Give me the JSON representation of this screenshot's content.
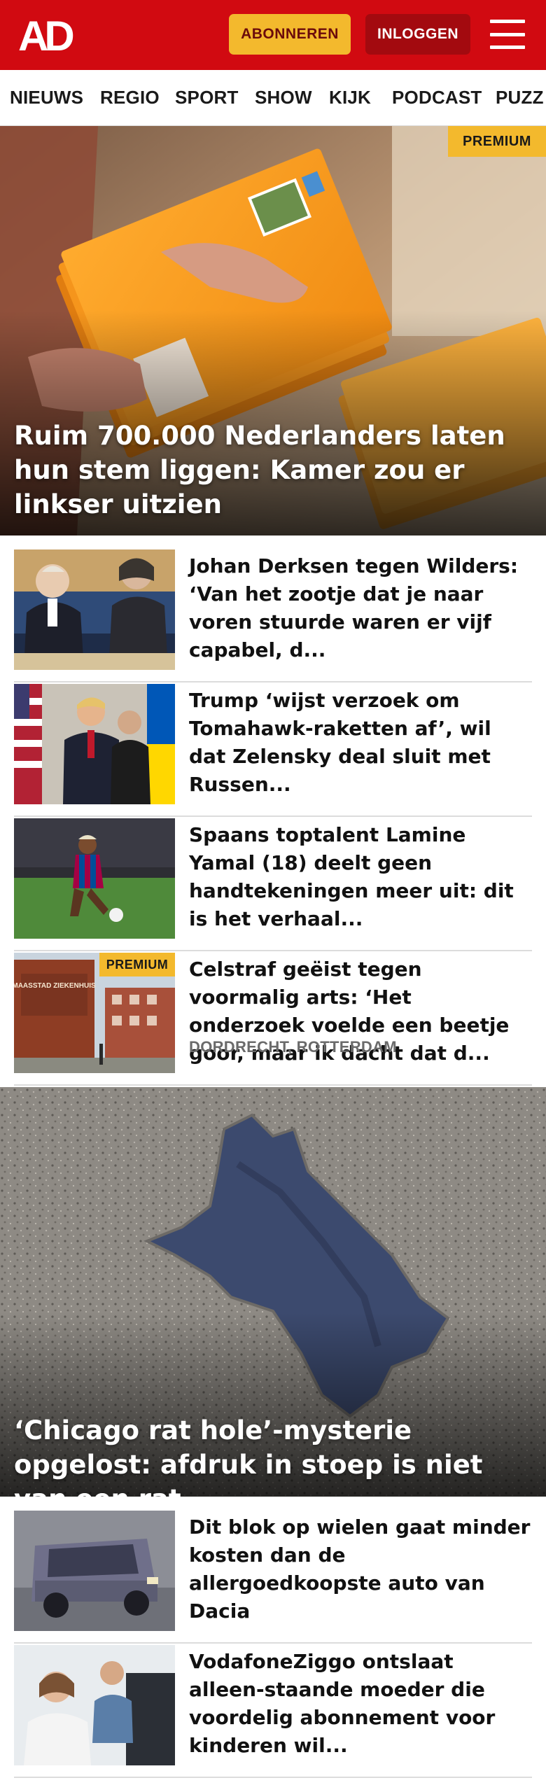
{
  "header": {
    "logo_text": "AD",
    "subscribe_label": "ABONNEREN",
    "login_label": "INLOGGEN",
    "brand_red": "#d10a11"
  },
  "nav": {
    "items": [
      "NIEUWS",
      "REGIO",
      "SPORT",
      "SHOW",
      "KIJK",
      "PODCAST",
      "PUZZ"
    ]
  },
  "hero1": {
    "title": "Ruim 700.000 Nederlanders laten hun stem liggen: Kamer zou er linkser uitzien",
    "badge": "PREMIUM"
  },
  "articles1": [
    {
      "title": "Johan Derksen tegen Wilders: ‘Van het zootje dat je naar voren stuurde waren er vijf capabel, d...",
      "meta": "",
      "badge": ""
    },
    {
      "title": "Trump ‘wijst verzoek om Tomahawk-raketten af’, wil dat Zelensky deal sluit met Russen...",
      "meta": "",
      "badge": ""
    },
    {
      "title": "Spaans toptalent Lamine Yamal (18) deelt geen handtekeningen meer uit: dit is het verhaal...",
      "meta": "",
      "badge": ""
    },
    {
      "title": "Celstraf geëist tegen voormalig arts: ‘Het onderzoek voelde een beetje goor, maar ik dacht dat d...",
      "meta": "DORDRECHT, ROTTERDAM",
      "badge": "PREMIUM",
      "sign_text": "MAASSTAD ZIEKENHUIS"
    }
  ],
  "hero2": {
    "title": "‘Chicago rat hole’-mysterie opgelost: afdruk in stoep is niet van een rat"
  },
  "articles2": [
    {
      "title": "Dit blok op wielen gaat minder kosten dan de allergoedkoopste auto van Dacia"
    },
    {
      "title": "VodafoneZiggo ontslaat alleen-staande moeder die voordelig abonnement voor kinderen wil..."
    }
  ]
}
